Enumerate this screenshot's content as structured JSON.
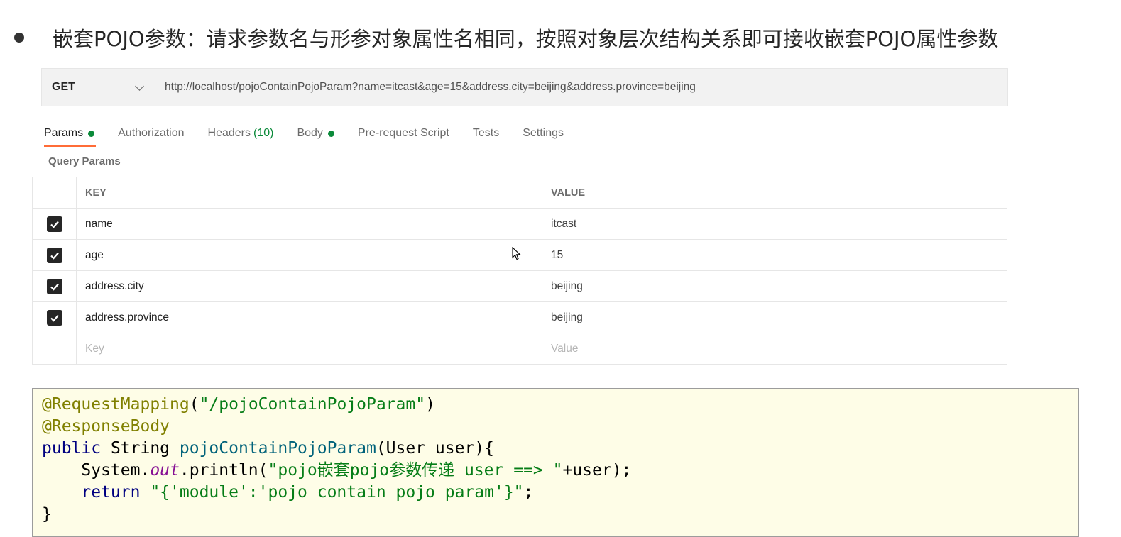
{
  "headline": {
    "text": "嵌套POJO参数：请求参数名与形参对象属性名相同，按照对象层次结构关系即可接收嵌套POJO属性参数"
  },
  "request": {
    "method": "GET",
    "url": "http://localhost/pojoContainPojoParam?name=itcast&age=15&address.city=beijing&address.province=beijing"
  },
  "tabs": [
    {
      "label": "Params",
      "dot": true,
      "active": true
    },
    {
      "label": "Authorization"
    },
    {
      "label": "Headers",
      "count": "(10)"
    },
    {
      "label": "Body",
      "dot": true
    },
    {
      "label": "Pre-request Script"
    },
    {
      "label": "Tests"
    },
    {
      "label": "Settings"
    }
  ],
  "query_params": {
    "label": "Query Params",
    "key_header": "KEY",
    "value_header": "VALUE",
    "rows": [
      {
        "key": "name",
        "value": "itcast",
        "checked": true
      },
      {
        "key": "age",
        "value": "15",
        "checked": true
      },
      {
        "key": "address.city",
        "value": "beijing",
        "checked": true
      },
      {
        "key": "address.province",
        "value": "beijing",
        "checked": true
      }
    ],
    "key_placeholder": "Key",
    "value_placeholder": "Value"
  },
  "code": {
    "annotation1": "@RequestMapping",
    "paren_open": "(",
    "mapping_path": "\"/pojoContainPojoParam\"",
    "paren_close": ")",
    "annotation2": "@ResponseBody",
    "kw_public": "public",
    "return_type": " String ",
    "method_name": "pojoContainPojoParam",
    "params": "(User user){",
    "indent": "    ",
    "sys": "System.",
    "out": "out",
    "println": ".println(",
    "print_str_open": "\"pojo",
    "print_str_zh": "嵌套",
    "print_str_mid": "pojo",
    "print_str_zh2": "参数传递",
    "print_str_end": " user ==> \"",
    "print_tail": "+user);",
    "kw_return": "return",
    "return_str": " \"{'module':'pojo contain pojo param'}\"",
    "semicolon": ";",
    "close_brace": "}"
  }
}
